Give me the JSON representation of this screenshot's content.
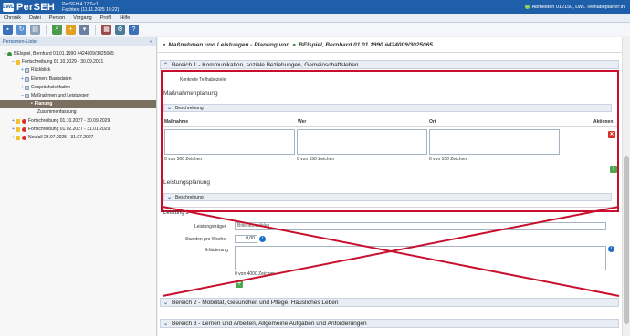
{
  "app": {
    "logo_mark": "LWL",
    "name": "PerSEH",
    "version": "PerSEH 4.17.0-r1",
    "fachtext": "Fachtext (11.11.2025 15:22)",
    "user": "Abmelden 012150, LWL Teilhabeplaner:in"
  },
  "menu": [
    "Chronik",
    "Datei",
    "Person",
    "Vorgang",
    "Profil",
    "Hilfe"
  ],
  "toolbar_icons": [
    "save-icon",
    "refresh-icon",
    "print-icon",
    "search-person-icon",
    "add-person-icon",
    "export-icon",
    "calculator-icon",
    "settings-icon",
    "help-icon"
  ],
  "sidebar": {
    "title": "Personen-Liste",
    "collapse": "«",
    "tree": [
      {
        "label": "BEIspiel, Bernhard 01.01.1990 #424009/3025065",
        "toggle": "–",
        "indent": 0
      },
      {
        "label": "Fortschreibung 01.10.2029 - 30.09.2031",
        "toggle": "–",
        "indent": 1
      },
      {
        "label": "Rückblick",
        "toggle": "+",
        "indent": 2
      },
      {
        "label": "Element Basisdaten",
        "toggle": "+",
        "indent": 2
      },
      {
        "label": "Gesprächsleitfaden",
        "toggle": "+",
        "indent": 2
      },
      {
        "label": "Maßnahmen und Leistungen",
        "toggle": "–",
        "indent": 2
      },
      {
        "label": "Planung",
        "toggle": "",
        "indent": 3,
        "selected": true
      },
      {
        "label": "Zusammenfassung",
        "toggle": "",
        "indent": 3
      },
      {
        "label": "Fortschreibung 01.10.2027 - 30.09.2029",
        "toggle": "+",
        "indent": 1
      },
      {
        "label": "Fortschreibung 01.02.2027 - 31.01.2029",
        "toggle": "+",
        "indent": 1
      },
      {
        "label": "Neufall 23.07.2025 - 31.07.2027",
        "toggle": "+",
        "indent": 1
      }
    ]
  },
  "main": {
    "header": "Maßnahmen und Leistungen - Planung von",
    "person": "BEIspiel, Bernhard 01.01.1990 #424009/3025065",
    "bereich1": "Bereich 1 - Kommunikation, soziale Beziehungen, Gemeinschaftsleben",
    "konkrete_ziele": "Konkrete Teilhabeziele",
    "massnahmenplanung": "Maßnahmenplanung",
    "beschreibung": "Beschreibung",
    "columns": [
      "Maßnahme",
      "Wer",
      "Ort",
      "Aktionen"
    ],
    "counters": [
      "0 von 500 Zeichen",
      "0 von 150 Zeichen",
      "0 von 150 Zeichen"
    ],
    "leistungsplanung": "Leistungsplanung",
    "beschreibung2": "Beschreibung",
    "leistung1": "Leistung 1",
    "leistungstraeger_label": "Leistungsträger",
    "leistungstraeger_value": "Bitte auswählen",
    "stunden_label": "Stunden pro Woche",
    "stunden_value": "0,00",
    "erlaeuterung_label": "Erläuterung",
    "erlaeuterung_counter": "0 von 4000 Zeichen",
    "bereich2": "Bereich 2 - Mobilität, Gesundheit und Pflege, Häusliches Leben",
    "bereich3": "Bereich 3 - Lernen und Arbeiten, Allgemeine Aufgaben und Anforderungen"
  },
  "colors": {
    "brand": "#1f5ea8",
    "annotation_red": "#c8102e"
  }
}
